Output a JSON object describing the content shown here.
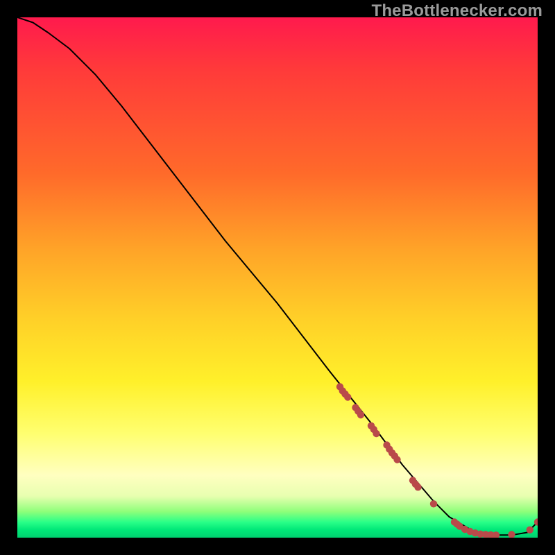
{
  "watermark": "TheBottlenecker.com",
  "chart_data": {
    "type": "line",
    "title": "",
    "xlabel": "",
    "ylabel": "",
    "xlim": [
      0,
      100
    ],
    "ylim": [
      0,
      100
    ],
    "grid": false,
    "series": [
      {
        "name": "curve",
        "x": [
          0,
          3,
          6,
          10,
          15,
          20,
          30,
          40,
          50,
          60,
          68,
          74,
          80,
          83,
          88,
          92,
          95,
          98,
          100
        ],
        "y": [
          100,
          99,
          97,
          94,
          89,
          83,
          70,
          57,
          45,
          32,
          22,
          14,
          7,
          4,
          1,
          0.5,
          0.5,
          1,
          3
        ],
        "stroke": "#000000",
        "stroke_width": 2
      }
    ],
    "points": {
      "name": "markers",
      "color": "#b94a4a",
      "xy": [
        [
          62,
          29
        ],
        [
          62.5,
          28.2
        ],
        [
          63,
          27.6
        ],
        [
          63.5,
          27
        ],
        [
          65,
          25
        ],
        [
          65.5,
          24.3
        ],
        [
          66,
          23.6
        ],
        [
          68,
          21.5
        ],
        [
          68.5,
          20.8
        ],
        [
          69,
          20
        ],
        [
          71,
          17.8
        ],
        [
          71.5,
          17
        ],
        [
          72,
          16.3
        ],
        [
          72.5,
          15.7
        ],
        [
          73,
          15
        ],
        [
          76,
          11
        ],
        [
          76.5,
          10.3
        ],
        [
          77,
          9.7
        ],
        [
          80,
          6.5
        ],
        [
          84,
          3
        ],
        [
          84.5,
          2.6
        ],
        [
          85,
          2.2
        ],
        [
          86,
          1.6
        ],
        [
          87,
          1.2
        ],
        [
          88,
          0.9
        ],
        [
          89,
          0.7
        ],
        [
          90,
          0.6
        ],
        [
          91,
          0.55
        ],
        [
          92,
          0.5
        ],
        [
          95,
          0.6
        ],
        [
          98.5,
          1.5
        ],
        [
          100,
          3
        ]
      ]
    },
    "background_gradient": {
      "direction": "vertical",
      "stops": [
        {
          "pos": 0,
          "color": "#ff1a4d"
        },
        {
          "pos": 10,
          "color": "#ff3a3a"
        },
        {
          "pos": 30,
          "color": "#ff6a2a"
        },
        {
          "pos": 45,
          "color": "#ffa528"
        },
        {
          "pos": 58,
          "color": "#ffd028"
        },
        {
          "pos": 70,
          "color": "#fff02a"
        },
        {
          "pos": 80,
          "color": "#ffff70"
        },
        {
          "pos": 88,
          "color": "#ffffc0"
        },
        {
          "pos": 92,
          "color": "#e8ffb0"
        },
        {
          "pos": 95,
          "color": "#8eff7a"
        },
        {
          "pos": 97,
          "color": "#2aff88"
        },
        {
          "pos": 98.5,
          "color": "#00e878"
        },
        {
          "pos": 100,
          "color": "#00d070"
        }
      ]
    }
  }
}
